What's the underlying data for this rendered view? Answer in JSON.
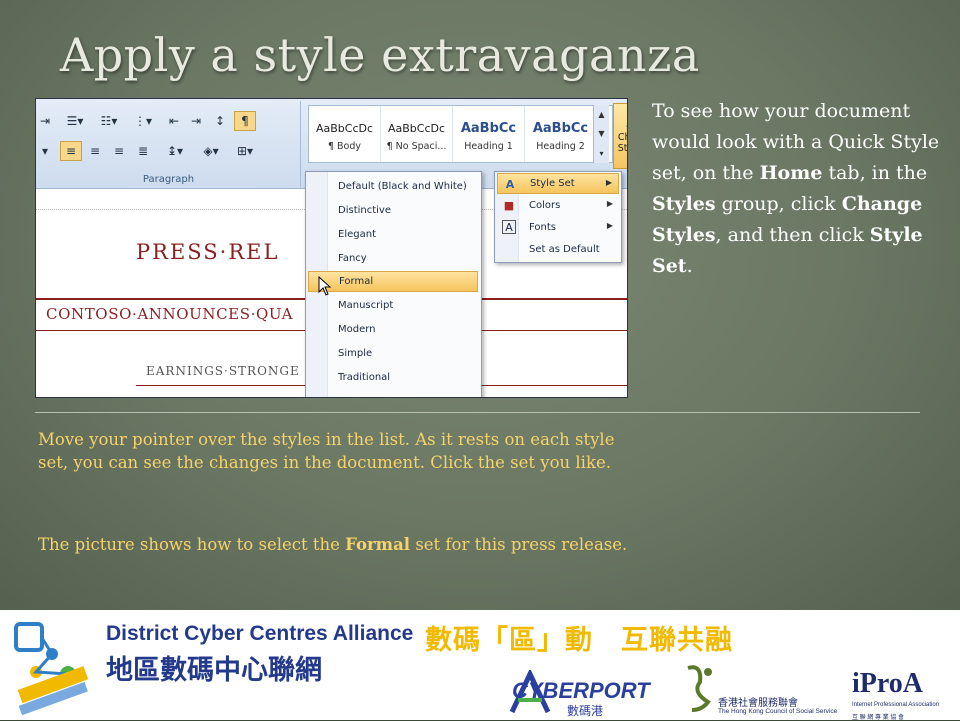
{
  "slide": {
    "title": "Apply a style extravaganza",
    "side_text": [
      {
        "t": "To see how your document would look with a Quick Style set, on the ",
        "b": false
      },
      {
        "t": "Home",
        "b": true
      },
      {
        "t": " tab, in the ",
        "b": false
      },
      {
        "t": "Styles",
        "b": true
      },
      {
        "t": " group, click ",
        "b": false
      },
      {
        "t": "Change Styles",
        "b": true
      },
      {
        "t": ", and then click ",
        "b": false
      },
      {
        "t": "Style Set",
        "b": true
      },
      {
        "t": ".",
        "b": false
      }
    ],
    "note1": "Move your pointer over the styles in the list. As it rests on each style set, you can see the changes in the document. Click the set you like.",
    "note2_pre": "The picture shows how to select the ",
    "note2_bold": "Formal",
    "note2_post": " set for this press release."
  },
  "ribbon": {
    "group_label": "Paragraph",
    "styles": [
      {
        "sample": "AaBbCcDc",
        "name": "¶ Body",
        "heading": false
      },
      {
        "sample": "AaBbCcDc",
        "name": "¶ No Spaci...",
        "heading": false
      },
      {
        "sample": "AaBbCc",
        "name": "Heading 1",
        "heading": true
      },
      {
        "sample": "AaBbCc",
        "name": "Heading 2",
        "heading": true
      }
    ],
    "change_styles": {
      "line1": "Change",
      "line2": "Styles ▾"
    }
  },
  "document": {
    "press": "PRESS·REL",
    "contoso": "CONTOSO·ANNOUNCES·QUA",
    "earnings": "EARNINGS·STRONGE"
  },
  "style_set_menu": {
    "items": [
      "Default (Black and White)",
      "Distinctive",
      "Elegant",
      "Fancy",
      "Formal",
      "Manuscript",
      "Modern",
      "Simple",
      "Traditional"
    ],
    "selected": "Formal"
  },
  "change_styles_menu": {
    "items": [
      {
        "label": "Style Set",
        "icon": "style-set-icon",
        "submenu": true
      },
      {
        "label": "Colors",
        "icon": "colors-icon",
        "submenu": true
      },
      {
        "label": "Fonts",
        "icon": "fonts-icon",
        "submenu": true
      },
      {
        "label": "Set as Default",
        "icon": "",
        "submenu": false
      }
    ],
    "selected": "Style Set"
  },
  "footer": {
    "dcca_en": "District Cyber Centres Alliance",
    "dcca_zh": "地區數碼中心聯網",
    "slogan": "數碼「區」動　互聯共融",
    "logo_zh": "數碼「區」動 互聯共融",
    "cyberport": "CYBERPORT",
    "cyberport_zh": "數碼港",
    "hkcss_zh": "香港社會服務聯會",
    "hkcss_en": "The Hong Kong Council of Social Service",
    "ipro": "iProA",
    "ipro_sub": "Internet Professional Association",
    "ipro_zh": "互 聯 網 專 業 協 會"
  },
  "colors": {
    "note": "#f6d36a",
    "accent": "#8a1f1f",
    "menu_highlight": "#f6c45d"
  }
}
